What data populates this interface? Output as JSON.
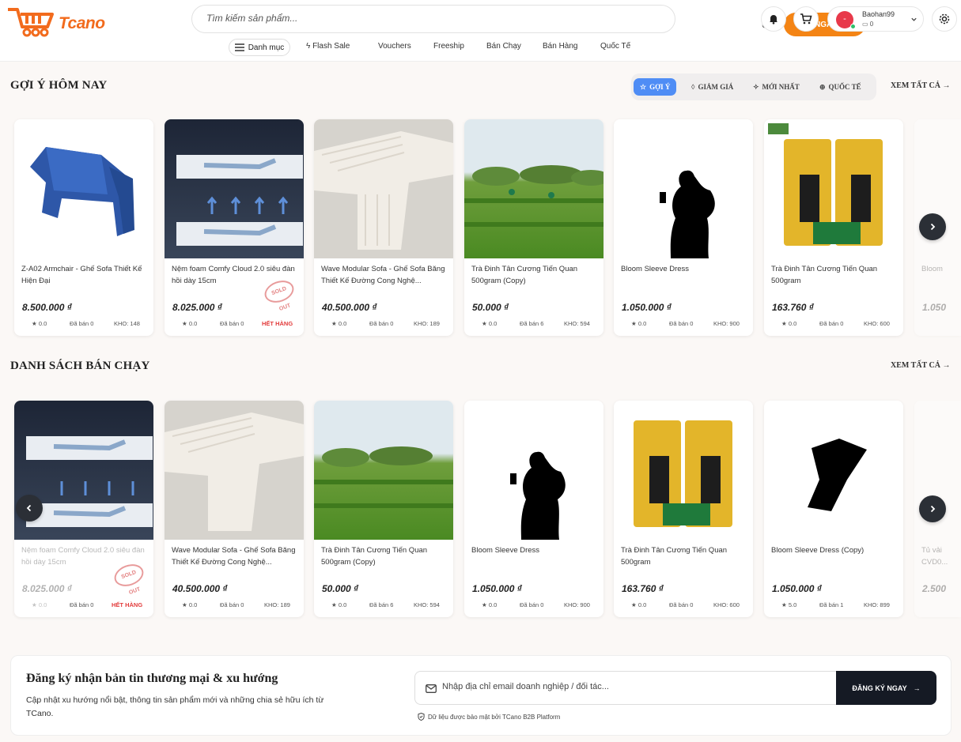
{
  "brand": {
    "name": "Tcano",
    "color": "#f26b1d"
  },
  "search": {
    "placeholder": "Tìm kiếm sản phẩm...",
    "button": "TÌM NGAY"
  },
  "user": {
    "name": "Baohan99",
    "balance": "0",
    "avatar_initial": "-"
  },
  "nav": {
    "menu": "Danh mục",
    "items": [
      "Flash Sale",
      "Vouchers",
      "Freeship",
      "Bán Chạy",
      "Bán Hàng",
      "Quốc Tế"
    ]
  },
  "section1": {
    "title": "GỢI Ý HÔM NAY",
    "see_all": "XEM TẤT CẢ",
    "tabs": [
      "GỢI Ý",
      "GIẢM GIÁ",
      "MỚI NHẤT",
      "QUỐC TẾ"
    ],
    "products": [
      {
        "name": "Z-A02 Armchair - Ghế Sofa Thiết Kế Hiện Đại",
        "price": "8.500.000 ₫",
        "rating": "0.0",
        "sold": "Đã bán 0",
        "stock": "KHO: 148"
      },
      {
        "name": "Nệm foam Comfy Cloud 2.0 siêu đàn hồi dày 15cm",
        "price": "8.025.000 ₫",
        "rating": "0.0",
        "sold": "Đã bán 0",
        "stock": "HẾT HÀNG",
        "badge": "SOLD OUT"
      },
      {
        "name": "Wave Modular Sofa - Ghế Sofa Băng Thiết Kế Đường Cong Nghệ...",
        "price": "40.500.000 ₫",
        "rating": "0.0",
        "sold": "Đã bán 0",
        "stock": "KHO: 189"
      },
      {
        "name": "Trà Đinh Tân Cương Tiến Quan 500gram (Copy)",
        "price": "50.000 ₫",
        "rating": "0.0",
        "sold": "Đã bán 6",
        "stock": "KHO: 594"
      },
      {
        "name": "Bloom Sleeve Dress",
        "price": "1.050.000 ₫",
        "rating": "0.0",
        "sold": "Đã bán 0",
        "stock": "KHO: 900"
      },
      {
        "name": "Trà Đinh Tân Cương Tiến Quan 500gram",
        "price": "163.760 ₫",
        "rating": "0.0",
        "sold": "Đã bán 0",
        "stock": "KHO: 600"
      },
      {
        "name": "Bloom",
        "price": "1.050"
      }
    ]
  },
  "section2": {
    "title": "DANH SÁCH BÁN CHẠY",
    "see_all": "XEM TẤT CẢ",
    "products": [
      {
        "name": "Nệm foam Comfy Cloud 2.0 siêu đàn hồi dày 15cm",
        "price": "8.025.000 ₫",
        "rating": "0.0",
        "sold": "Đã bán 0",
        "stock": "HẾT HÀNG",
        "badge": "SOLD OUT"
      },
      {
        "name": "Wave Modular Sofa - Ghế Sofa Băng Thiết Kế Đường Cong Nghệ...",
        "price": "40.500.000 ₫",
        "rating": "0.0",
        "sold": "Đã bán 0",
        "stock": "KHO: 189"
      },
      {
        "name": "Trà Đinh Tân Cương Tiến Quan 500gram (Copy)",
        "price": "50.000 ₫",
        "rating": "0.0",
        "sold": "Đã bán 6",
        "stock": "KHO: 594"
      },
      {
        "name": "Bloom Sleeve Dress",
        "price": "1.050.000 ₫",
        "rating": "0.0",
        "sold": "Đã bán 0",
        "stock": "KHO: 900"
      },
      {
        "name": "Trà Đinh Tân Cương Tiến Quan 500gram",
        "price": "163.760 ₫",
        "rating": "0.0",
        "sold": "Đã bán 0",
        "stock": "KHO: 600"
      },
      {
        "name": "Bloom Sleeve Dress (Copy)",
        "price": "1.050.000 ₫",
        "rating": "5.0",
        "sold": "Đã bán 1",
        "stock": "KHO: 899"
      },
      {
        "name": "Tủ vải CVD0...",
        "price": "2.500"
      }
    ]
  },
  "newsletter": {
    "title": "Đăng ký nhận bản tin thương mại & xu hướng",
    "desc": "Cập nhật xu hướng nổi bật, thông tin sản phẩm mới và những chia sẻ hữu ích từ TCano.",
    "placeholder": "Nhập địa chỉ email doanh nghiệp / đối tác...",
    "button": "ĐĂNG KÝ NGAY",
    "note": "Dữ liệu được bảo mật bởi TCano B2B Platform"
  }
}
